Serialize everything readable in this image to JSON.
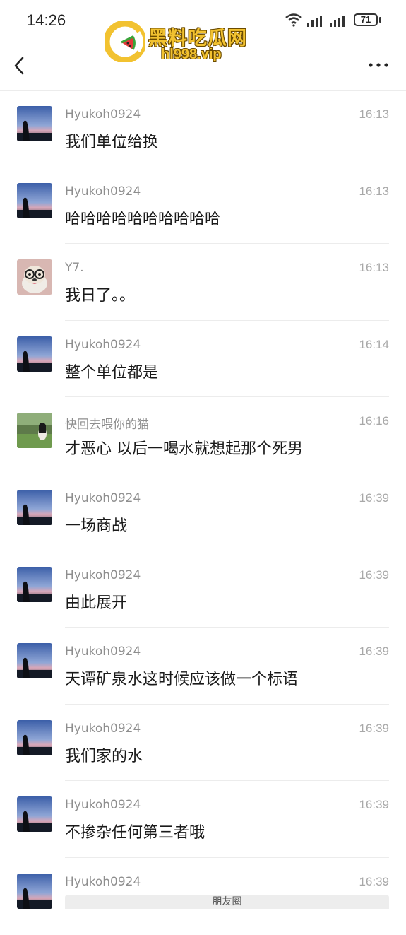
{
  "status_bar": {
    "time": "14:26",
    "battery": "71",
    "icons": [
      "wifi-icon",
      "signal-icon",
      "signal-icon",
      "battery-icon"
    ]
  },
  "watermark": {
    "title": "黑料吃瓜网",
    "url": "hl998.vip"
  },
  "nav": {
    "back_icon": "chevron-left-icon",
    "more_icon": "more-dots-icon"
  },
  "messages": [
    {
      "sender": "Hyukoh0924",
      "time": "16:13",
      "text": "我们单位给换",
      "avatar": "landscape"
    },
    {
      "sender": "Hyukoh0924",
      "time": "16:13",
      "text": "哈哈哈哈哈哈哈哈哈哈",
      "avatar": "landscape"
    },
    {
      "sender": "Y7.",
      "time": "16:13",
      "text": "我日了。。",
      "avatar": "dog"
    },
    {
      "sender": "Hyukoh0924",
      "time": "16:14",
      "text": "整个单位都是",
      "avatar": "landscape"
    },
    {
      "sender": "快回去喂你的猫",
      "time": "16:16",
      "text": "才恶心 以后一喝水就想起那个死男",
      "avatar": "girl"
    },
    {
      "sender": "Hyukoh0924",
      "time": "16:39",
      "text": "一场商战",
      "avatar": "landscape"
    },
    {
      "sender": "Hyukoh0924",
      "time": "16:39",
      "text": "由此展开",
      "avatar": "landscape"
    },
    {
      "sender": "Hyukoh0924",
      "time": "16:39",
      "text": "天谭矿泉水这时候应该做一个标语",
      "avatar": "landscape"
    },
    {
      "sender": "Hyukoh0924",
      "time": "16:39",
      "text": "我们家的水",
      "avatar": "landscape"
    },
    {
      "sender": "Hyukoh0924",
      "time": "16:39",
      "text": "不掺杂任何第三者哦",
      "avatar": "landscape"
    },
    {
      "sender": "Hyukoh0924",
      "time": "16:39",
      "text": "",
      "avatar": "landscape"
    }
  ],
  "bottom_card": {
    "label": "朋友圈"
  }
}
